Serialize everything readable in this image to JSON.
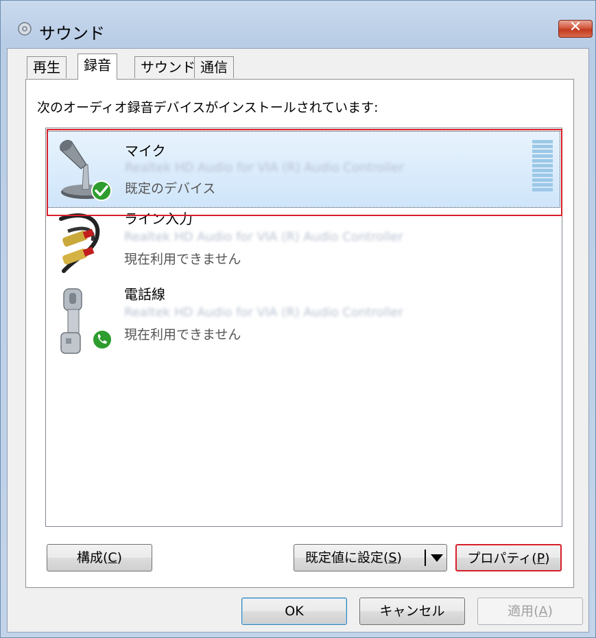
{
  "window": {
    "title": "サウンド",
    "close_label": "✕"
  },
  "tabs": [
    {
      "label": "再生"
    },
    {
      "label": "録音"
    },
    {
      "label": "サウンド"
    },
    {
      "label": "通信"
    }
  ],
  "panel": {
    "instruction": "次のオーディオ録音デバイスがインストールされています:"
  },
  "devices": [
    {
      "name": "マイク",
      "description": "Realtek HD Audio for VIA (R) Audio Controller",
      "status": "既定のデバイス",
      "icon": "microphone-icon",
      "badge": "check-badge-icon"
    },
    {
      "name": "ライン入力",
      "description": "Realtek HD Audio for VIA (R) Audio Controller",
      "status": "現在利用できません",
      "icon": "line-in-cable-icon"
    },
    {
      "name": "電話線",
      "description": "Realtek HD Audio for VIA (R) Audio Controller",
      "status": "現在利用できません",
      "icon": "telephone-icon",
      "badge": "phone-badge-icon"
    }
  ],
  "buttons": {
    "configure": {
      "label": "構成(",
      "key": "C",
      "suffix": ")"
    },
    "set_default": {
      "label": "既定値に設定(",
      "key": "S",
      "suffix": ")"
    },
    "properties": {
      "label": "プロパティ(",
      "key": "P",
      "suffix": ")"
    },
    "ok": {
      "label": "OK"
    },
    "cancel": {
      "label": "キャンセル"
    },
    "apply": {
      "label": "適用(",
      "key": "A",
      "suffix": ")"
    }
  },
  "colors": {
    "highlight": "#d81e2a",
    "selection": "#cfe5fa",
    "check_green": "#2e9c2e"
  }
}
